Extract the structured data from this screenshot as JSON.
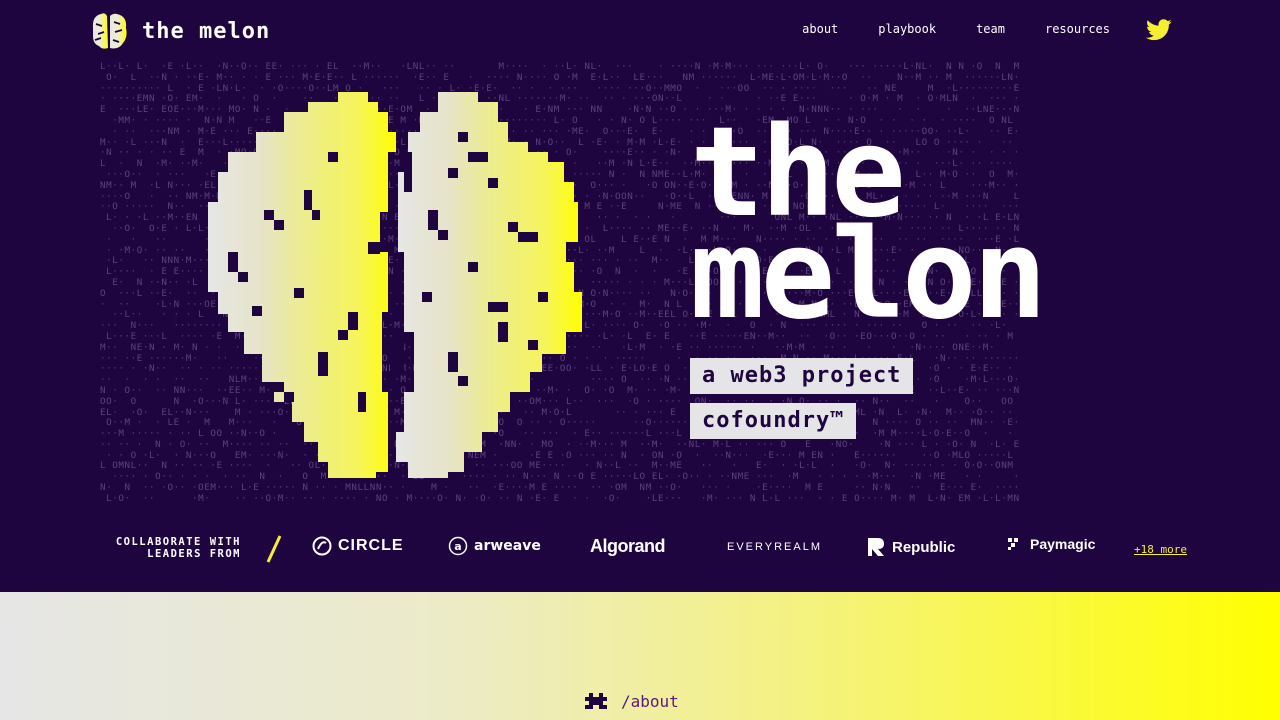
{
  "header": {
    "brand": "the melon",
    "nav": [
      "about",
      "playbook",
      "team",
      "resources"
    ],
    "social_icon": "twitter-icon"
  },
  "hero": {
    "title_line1": "the",
    "title_line2": "melon",
    "tag_line1": "a web3 project",
    "tag_line2": "cofoundry™",
    "background_letters": "MELON"
  },
  "partners": {
    "label": "COLLABORATE WITH LEADERS FROM",
    "items": [
      "CIRCLE",
      "arweave",
      "Algorand",
      "EVERYREALM",
      "Republic",
      "Paymagic"
    ],
    "more": "+18 more"
  },
  "lower": {
    "about_link": "/about"
  },
  "colors": {
    "background": "#1f0540",
    "accent_yellow": "#f4ef30",
    "light_gray": "#e6e6e6",
    "text_purple": "#5a1a7a"
  }
}
